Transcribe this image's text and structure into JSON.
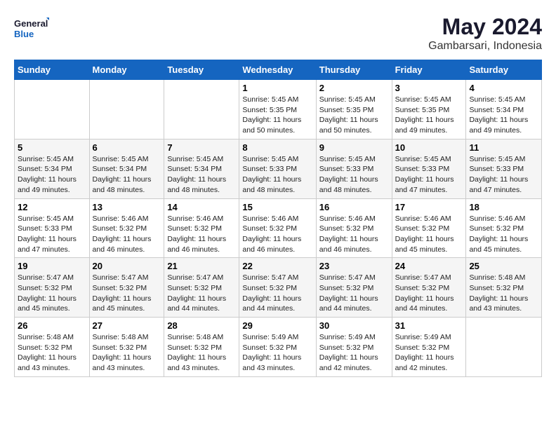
{
  "logo": {
    "line1": "General",
    "line2": "Blue"
  },
  "title": "May 2024",
  "subtitle": "Gambarsari, Indonesia",
  "weekdays": [
    "Sunday",
    "Monday",
    "Tuesday",
    "Wednesday",
    "Thursday",
    "Friday",
    "Saturday"
  ],
  "weeks": [
    [
      {
        "day": "",
        "info": ""
      },
      {
        "day": "",
        "info": ""
      },
      {
        "day": "",
        "info": ""
      },
      {
        "day": "1",
        "info": "Sunrise: 5:45 AM\nSunset: 5:35 PM\nDaylight: 11 hours\nand 50 minutes."
      },
      {
        "day": "2",
        "info": "Sunrise: 5:45 AM\nSunset: 5:35 PM\nDaylight: 11 hours\nand 50 minutes."
      },
      {
        "day": "3",
        "info": "Sunrise: 5:45 AM\nSunset: 5:35 PM\nDaylight: 11 hours\nand 49 minutes."
      },
      {
        "day": "4",
        "info": "Sunrise: 5:45 AM\nSunset: 5:34 PM\nDaylight: 11 hours\nand 49 minutes."
      }
    ],
    [
      {
        "day": "5",
        "info": "Sunrise: 5:45 AM\nSunset: 5:34 PM\nDaylight: 11 hours\nand 49 minutes."
      },
      {
        "day": "6",
        "info": "Sunrise: 5:45 AM\nSunset: 5:34 PM\nDaylight: 11 hours\nand 48 minutes."
      },
      {
        "day": "7",
        "info": "Sunrise: 5:45 AM\nSunset: 5:34 PM\nDaylight: 11 hours\nand 48 minutes."
      },
      {
        "day": "8",
        "info": "Sunrise: 5:45 AM\nSunset: 5:33 PM\nDaylight: 11 hours\nand 48 minutes."
      },
      {
        "day": "9",
        "info": "Sunrise: 5:45 AM\nSunset: 5:33 PM\nDaylight: 11 hours\nand 48 minutes."
      },
      {
        "day": "10",
        "info": "Sunrise: 5:45 AM\nSunset: 5:33 PM\nDaylight: 11 hours\nand 47 minutes."
      },
      {
        "day": "11",
        "info": "Sunrise: 5:45 AM\nSunset: 5:33 PM\nDaylight: 11 hours\nand 47 minutes."
      }
    ],
    [
      {
        "day": "12",
        "info": "Sunrise: 5:45 AM\nSunset: 5:33 PM\nDaylight: 11 hours\nand 47 minutes."
      },
      {
        "day": "13",
        "info": "Sunrise: 5:46 AM\nSunset: 5:32 PM\nDaylight: 11 hours\nand 46 minutes."
      },
      {
        "day": "14",
        "info": "Sunrise: 5:46 AM\nSunset: 5:32 PM\nDaylight: 11 hours\nand 46 minutes."
      },
      {
        "day": "15",
        "info": "Sunrise: 5:46 AM\nSunset: 5:32 PM\nDaylight: 11 hours\nand 46 minutes."
      },
      {
        "day": "16",
        "info": "Sunrise: 5:46 AM\nSunset: 5:32 PM\nDaylight: 11 hours\nand 46 minutes."
      },
      {
        "day": "17",
        "info": "Sunrise: 5:46 AM\nSunset: 5:32 PM\nDaylight: 11 hours\nand 45 minutes."
      },
      {
        "day": "18",
        "info": "Sunrise: 5:46 AM\nSunset: 5:32 PM\nDaylight: 11 hours\nand 45 minutes."
      }
    ],
    [
      {
        "day": "19",
        "info": "Sunrise: 5:47 AM\nSunset: 5:32 PM\nDaylight: 11 hours\nand 45 minutes."
      },
      {
        "day": "20",
        "info": "Sunrise: 5:47 AM\nSunset: 5:32 PM\nDaylight: 11 hours\nand 45 minutes."
      },
      {
        "day": "21",
        "info": "Sunrise: 5:47 AM\nSunset: 5:32 PM\nDaylight: 11 hours\nand 44 minutes."
      },
      {
        "day": "22",
        "info": "Sunrise: 5:47 AM\nSunset: 5:32 PM\nDaylight: 11 hours\nand 44 minutes."
      },
      {
        "day": "23",
        "info": "Sunrise: 5:47 AM\nSunset: 5:32 PM\nDaylight: 11 hours\nand 44 minutes."
      },
      {
        "day": "24",
        "info": "Sunrise: 5:47 AM\nSunset: 5:32 PM\nDaylight: 11 hours\nand 44 minutes."
      },
      {
        "day": "25",
        "info": "Sunrise: 5:48 AM\nSunset: 5:32 PM\nDaylight: 11 hours\nand 43 minutes."
      }
    ],
    [
      {
        "day": "26",
        "info": "Sunrise: 5:48 AM\nSunset: 5:32 PM\nDaylight: 11 hours\nand 43 minutes."
      },
      {
        "day": "27",
        "info": "Sunrise: 5:48 AM\nSunset: 5:32 PM\nDaylight: 11 hours\nand 43 minutes."
      },
      {
        "day": "28",
        "info": "Sunrise: 5:48 AM\nSunset: 5:32 PM\nDaylight: 11 hours\nand 43 minutes."
      },
      {
        "day": "29",
        "info": "Sunrise: 5:49 AM\nSunset: 5:32 PM\nDaylight: 11 hours\nand 43 minutes."
      },
      {
        "day": "30",
        "info": "Sunrise: 5:49 AM\nSunset: 5:32 PM\nDaylight: 11 hours\nand 42 minutes."
      },
      {
        "day": "31",
        "info": "Sunrise: 5:49 AM\nSunset: 5:32 PM\nDaylight: 11 hours\nand 42 minutes."
      },
      {
        "day": "",
        "info": ""
      }
    ]
  ]
}
